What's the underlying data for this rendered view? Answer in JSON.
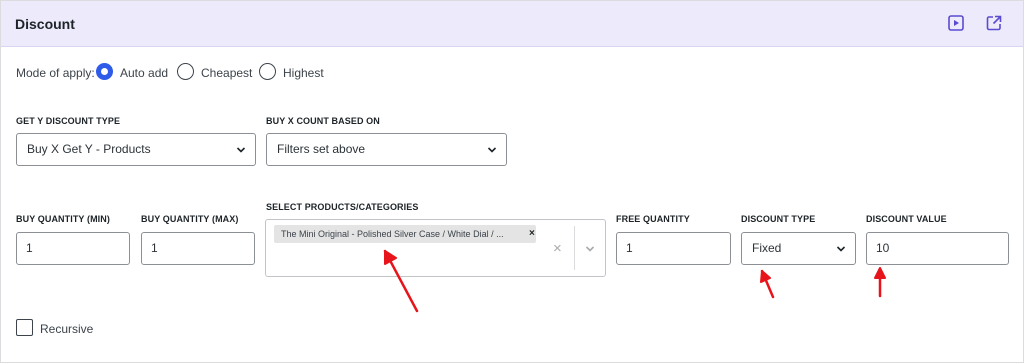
{
  "header": {
    "title": "Discount",
    "play_icon": "play-icon",
    "external_icon": "external-link-icon"
  },
  "mode": {
    "label": "Mode of apply:",
    "options": [
      {
        "label": "Auto add",
        "checked": true
      },
      {
        "label": "Cheapest",
        "checked": false
      },
      {
        "label": "Highest",
        "checked": false
      }
    ]
  },
  "get_y_type": {
    "label": "GET Y DISCOUNT TYPE",
    "value": "Buy X Get Y - Products"
  },
  "buy_x_count": {
    "label": "BUY X COUNT BASED ON",
    "value": "Filters set above"
  },
  "buy_qty_min": {
    "label": "BUY QUANTITY (MIN)",
    "value": "1"
  },
  "buy_qty_max": {
    "label": "BUY QUANTITY (MAX)",
    "value": "1"
  },
  "products": {
    "label": "SELECT PRODUCTS/CATEGORIES",
    "tag": "The Mini Original - Polished Silver Case / White Dial / ...",
    "tag_remove": "×",
    "clear": "×"
  },
  "free_qty": {
    "label": "FREE QUANTITY",
    "value": "1"
  },
  "discount_type": {
    "label": "DISCOUNT TYPE",
    "value": "Fixed"
  },
  "discount_value": {
    "label": "DISCOUNT VALUE",
    "value": "10"
  },
  "recursive": {
    "label": "Recursive",
    "checked": false
  },
  "colors": {
    "accent": "#2f5bea",
    "header_bg": "#eceafb",
    "annotation": "#e8141b"
  }
}
